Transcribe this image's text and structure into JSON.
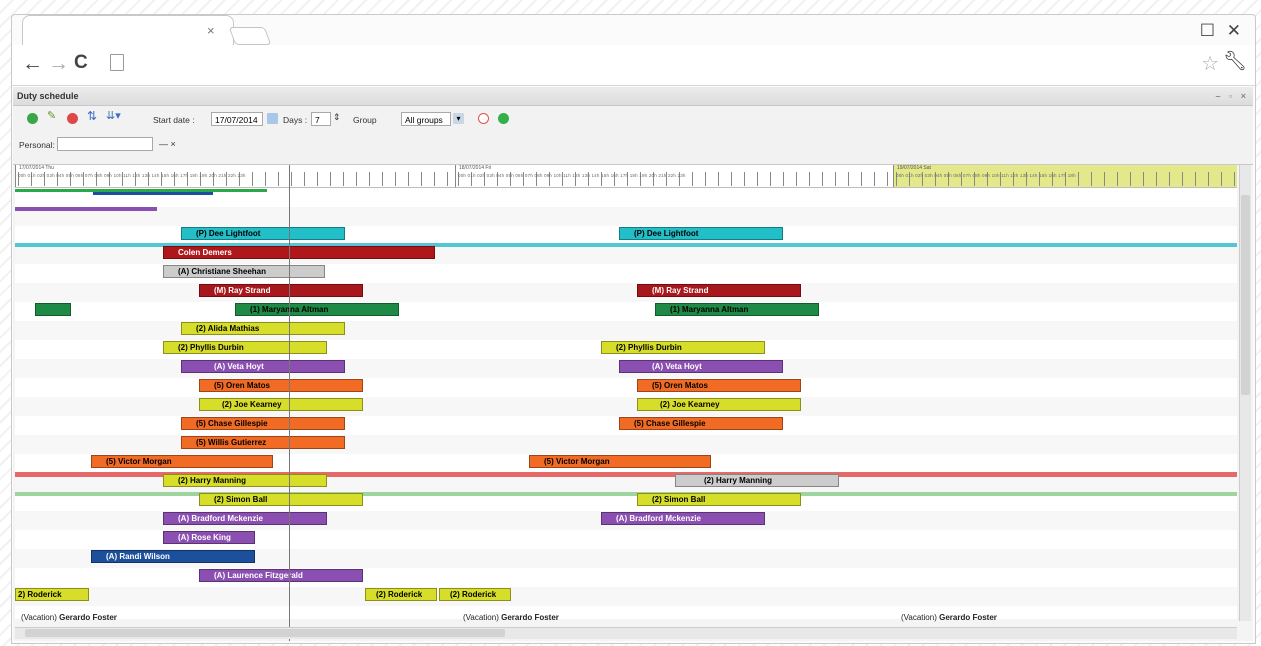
{
  "browser": {
    "tab_close": "×",
    "win_restore": "☐",
    "win_close": "✕",
    "back": "←",
    "forward": "→",
    "reload": "C"
  },
  "app": {
    "title": "Duty schedule",
    "toolbar": {
      "start_date_label": "Start date :",
      "start_date_value": "17/07/2014",
      "days_label": "Days :",
      "days_value": "7",
      "group_label": "Group",
      "group_value": "All groups",
      "personal_label": "Personal:",
      "personal_value": "",
      "personal_clear": "— ×"
    },
    "colors": {
      "cyan": "#23bfc9",
      "red": "#b0171b",
      "grey": "#cccccc",
      "green": "#1f8a45",
      "yellow": "#d7de2a",
      "purple": "#8a4fb0",
      "orange": "#f26b25",
      "blue": "#1c4f9c"
    },
    "bars": [
      {
        "label": "(P) Dee Lightfoot",
        "color": "cyan"
      },
      {
        "label": "(P) Dee Lightfoot",
        "color": "cyan"
      },
      {
        "label": "Colen Demers",
        "color": "red"
      },
      {
        "label": "(A) Christiane Sheehan",
        "color": "grey"
      },
      {
        "label": "(M) Ray Strand",
        "color": "red"
      },
      {
        "label": "(M) Ray Strand",
        "color": "red"
      },
      {
        "label": "(1) Maryanna Altman",
        "color": "green"
      },
      {
        "label": "(1) Maryanna Altman",
        "color": "green"
      },
      {
        "label": "(2) Alida Mathias",
        "color": "yellow"
      },
      {
        "label": "(2) Phyllis Durbin",
        "color": "yellow"
      },
      {
        "label": "(2) Phyllis Durbin",
        "color": "yellow"
      },
      {
        "label": "(A) Veta Hoyt",
        "color": "purple"
      },
      {
        "label": "(A) Veta Hoyt",
        "color": "purple"
      },
      {
        "label": "(5) Oren Matos",
        "color": "orange"
      },
      {
        "label": "(5) Oren Matos",
        "color": "orange"
      },
      {
        "label": "(2) Joe Kearney",
        "color": "yellow"
      },
      {
        "label": "(2) Joe Kearney",
        "color": "yellow"
      },
      {
        "label": "(5) Chase Gillespie",
        "color": "orange"
      },
      {
        "label": "(5) Chase Gillespie",
        "color": "orange"
      },
      {
        "label": "(5) Willis Gutierrez",
        "color": "orange"
      },
      {
        "label": "(5) Victor Morgan",
        "color": "orange"
      },
      {
        "label": "(5) Victor Morgan",
        "color": "orange"
      },
      {
        "label": "(2) Harry Manning",
        "color": "yellow"
      },
      {
        "label": "(2) Harry Manning",
        "color": "grey"
      },
      {
        "label": "(2) Simon Ball",
        "color": "yellow"
      },
      {
        "label": "(2) Simon Ball",
        "color": "yellow"
      },
      {
        "label": "(A) Bradford Mckenzie",
        "color": "purple"
      },
      {
        "label": "(A) Bradford Mckenzie",
        "color": "purple"
      },
      {
        "label": "(A) Rose King",
        "color": "purple"
      },
      {
        "label": "(A) Randi Wilson",
        "color": "blue"
      },
      {
        "label": "(A) Laurence Fitzgerald",
        "color": "purple"
      },
      {
        "label": "2) Roderick",
        "color": "yellow"
      },
      {
        "label": "(2) Roderick",
        "color": "yellow"
      },
      {
        "label": "(2) Roderick",
        "color": "yellow"
      }
    ],
    "vacation": [
      {
        "prefix": "(Vacation)",
        "name": "Gerardo Foster"
      },
      {
        "prefix": "(Vacation)",
        "name": "Gerardo Foster"
      },
      {
        "prefix": "(Vacation)",
        "name": "Gerardo Foster"
      }
    ]
  }
}
